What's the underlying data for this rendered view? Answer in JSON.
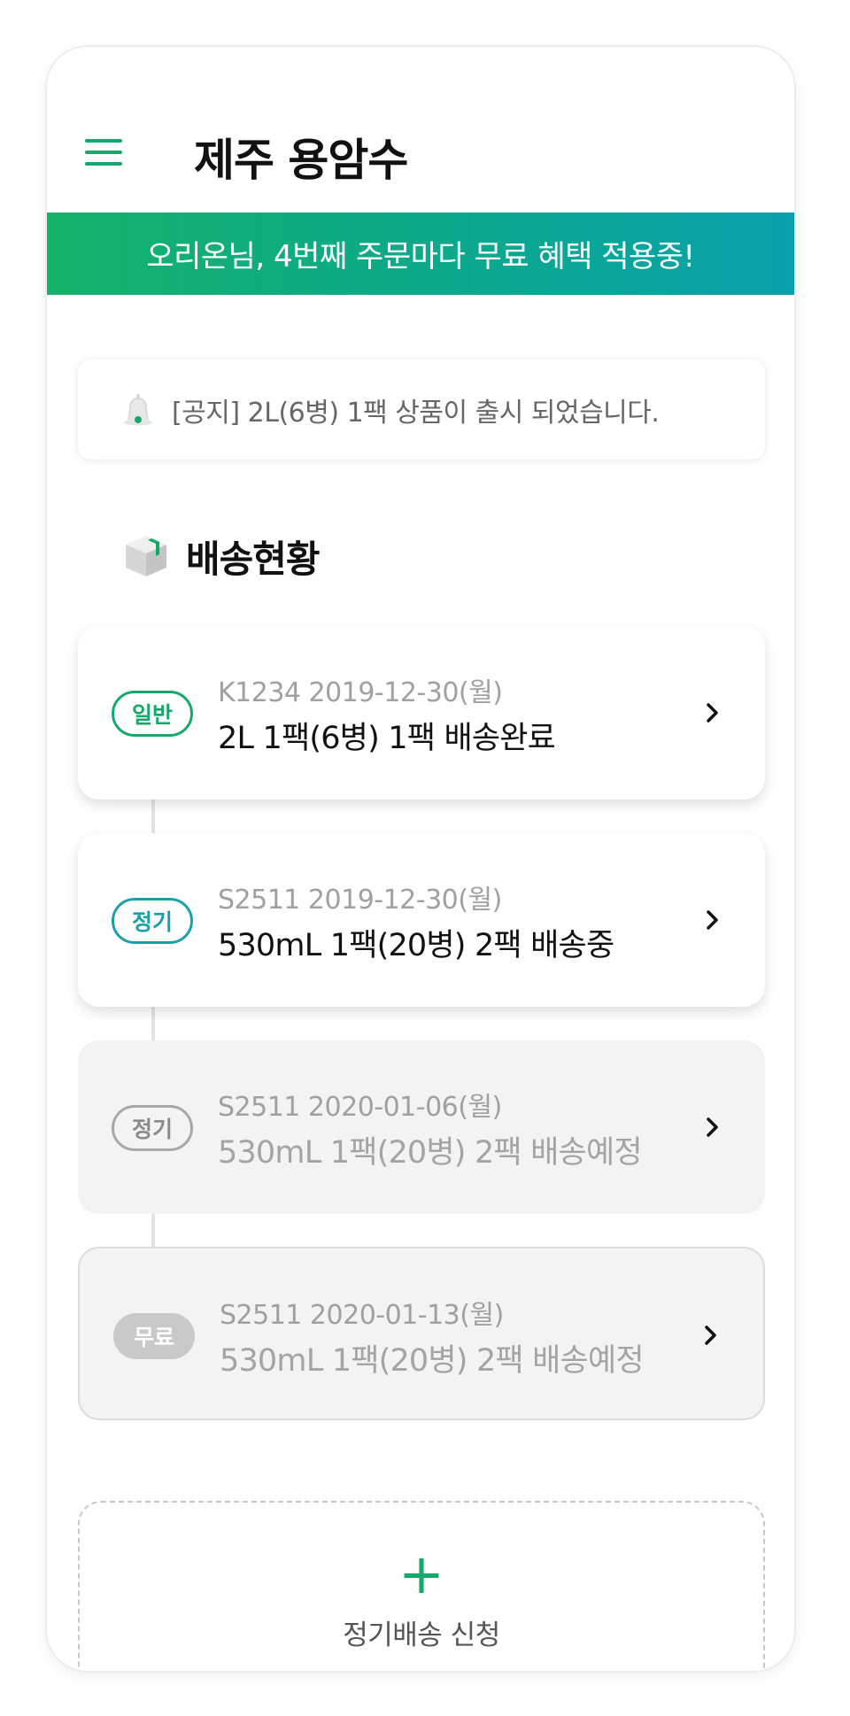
{
  "header": {
    "title": "제주 용암수"
  },
  "banner": {
    "text": "오리온님, 4번째 주문마다 무료 혜택 적용중!"
  },
  "notice": {
    "text": "[공지] 2L(6병) 1팩 상품이 출시 되었습니다."
  },
  "delivery": {
    "section_title": "배송현황",
    "items": [
      {
        "badge": "일반",
        "meta": "K1234 2019-12-30(월)",
        "description": "2L 1팩(6병) 1팩 배송완료"
      },
      {
        "badge": "정기",
        "meta": "S2511 2019-12-30(월)",
        "description": "530mL 1팩(20병) 2팩 배송중"
      },
      {
        "badge": "정기",
        "meta": "S2511 2020-01-06(월)",
        "description": "530mL 1팩(20병) 2팩 배송예정"
      },
      {
        "badge": "무료",
        "meta": "S2511 2020-01-13(월)",
        "description": "530mL 1팩(20병) 2팩 배송예정"
      }
    ]
  },
  "subscribe": {
    "plus": "+",
    "label": "정기배송 신청"
  },
  "colors": {
    "brand_green": "#16a86a",
    "brand_teal": "#1aa0a6",
    "banner_start": "#14b26a",
    "banner_end": "#0aa0ac"
  },
  "icons": {
    "menu": "hamburger-icon",
    "notice": "bell-icon",
    "section": "box-icon",
    "row": "chevron-right-icon",
    "add": "plus-icon"
  }
}
